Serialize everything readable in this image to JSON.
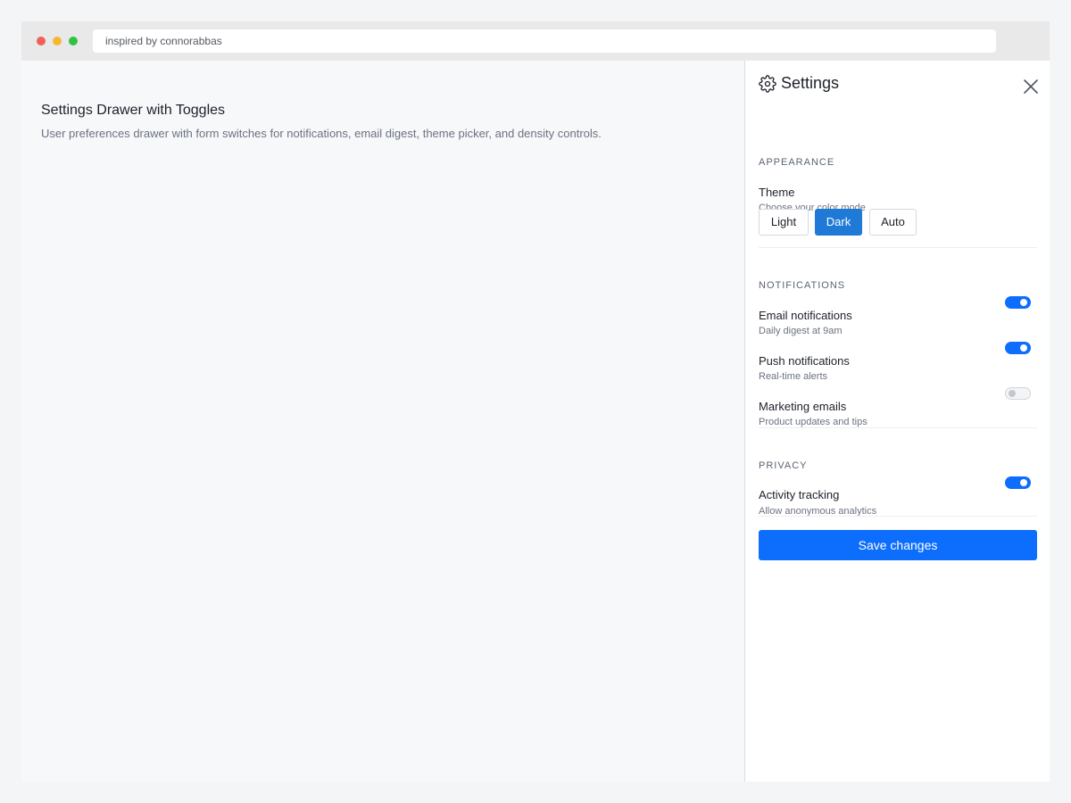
{
  "browser": {
    "url_text": "inspired by connorabbas"
  },
  "main": {
    "title": "Settings Drawer with Toggles",
    "subtitle": "User preferences drawer with form switches for notifications, email digest, theme picker, and density controls."
  },
  "drawer": {
    "title": "Settings",
    "header_icon": "gear-icon",
    "close_icon": "close-icon",
    "appearance": {
      "section_title": "APPEARANCE",
      "theme_label": "Theme",
      "theme_sub": "Choose your color mode",
      "options": [
        "Light",
        "Dark",
        "Auto"
      ],
      "selected": "Dark"
    },
    "notifications": {
      "section_title": "NOTIFICATIONS",
      "items": [
        {
          "label": "Email notifications",
          "sub": "Daily digest at 9am",
          "enabled": true
        },
        {
          "label": "Push notifications",
          "sub": "Real-time alerts",
          "enabled": true
        },
        {
          "label": "Marketing emails",
          "sub": "Product updates and tips",
          "enabled": false
        }
      ]
    },
    "privacy": {
      "section_title": "PRIVACY",
      "items": [
        {
          "label": "Activity tracking",
          "sub": "Allow anonymous analytics",
          "enabled": true
        }
      ]
    },
    "save_label": "Save changes"
  },
  "colors": {
    "accent": "#0d6efd",
    "segment_active": "#1e7ad6",
    "traffic_red": "#f25f57",
    "traffic_yellow": "#f7b731",
    "traffic_green": "#2ec441"
  }
}
